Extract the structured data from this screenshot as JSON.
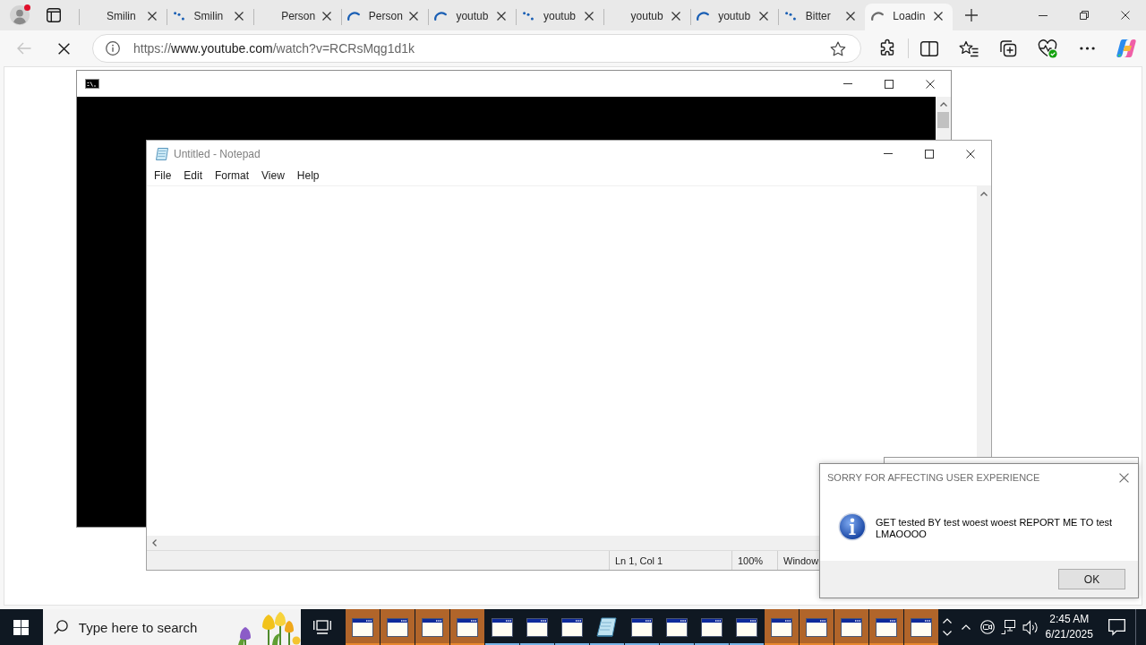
{
  "browser": {
    "tabs": [
      {
        "kind": "plain",
        "title": "Smilin",
        "selected": false
      },
      {
        "kind": "dots",
        "title": "Smilin",
        "selected": false
      },
      {
        "kind": "plain",
        "title": "Person",
        "selected": false
      },
      {
        "kind": "arc",
        "title": "Person",
        "selected": false
      },
      {
        "kind": "arc",
        "title": "youtub",
        "selected": false
      },
      {
        "kind": "dots",
        "title": "youtub",
        "selected": false
      },
      {
        "kind": "plain",
        "title": "youtub",
        "selected": false
      },
      {
        "kind": "arc",
        "title": "youtub",
        "selected": false
      },
      {
        "kind": "dots",
        "title": "Bitter",
        "selected": false
      },
      {
        "kind": "arc",
        "title": "Loadin",
        "selected": true
      }
    ],
    "navigation": {
      "back_disabled": true,
      "loading": true
    },
    "address_bar": {
      "scheme": "https://",
      "host": "www.youtube.com",
      "path": "/watch?v=RCRsMqg1d1k"
    }
  },
  "notepad": {
    "title": "Untitled - Notepad",
    "menu": [
      "File",
      "Edit",
      "Format",
      "View",
      "Help"
    ],
    "status": [
      "Ln 1, Col 1",
      "100%",
      "Window"
    ]
  },
  "dialog": {
    "title": "SORRY FOR AFFECTING USER EXPERIENCE",
    "message": "GET tested BY test woest woest REPORT ME TO test LMAOOOO",
    "button": "OK"
  },
  "taskbar": {
    "search": {
      "placeholder": "Type here to search"
    },
    "apps": [
      {
        "kind": "window",
        "flashing": true,
        "running": true
      },
      {
        "kind": "window",
        "flashing": true,
        "running": true
      },
      {
        "kind": "window",
        "flashing": true,
        "running": true
      },
      {
        "kind": "window",
        "flashing": true,
        "running": true
      },
      {
        "kind": "window",
        "flashing": false,
        "running": true
      },
      {
        "kind": "window",
        "flashing": false,
        "running": true
      },
      {
        "kind": "window",
        "flashing": false,
        "running": true
      },
      {
        "kind": "notepad",
        "flashing": false,
        "running": true
      },
      {
        "kind": "window",
        "flashing": false,
        "running": true
      },
      {
        "kind": "window",
        "flashing": false,
        "running": true
      },
      {
        "kind": "window",
        "flashing": false,
        "running": true
      },
      {
        "kind": "window",
        "flashing": false,
        "running": true
      },
      {
        "kind": "window",
        "flashing": true,
        "running": true
      },
      {
        "kind": "window",
        "flashing": true,
        "running": true
      },
      {
        "kind": "window",
        "flashing": true,
        "running": true
      },
      {
        "kind": "window",
        "flashing": true,
        "running": true
      },
      {
        "kind": "window",
        "flashing": true,
        "running": true
      }
    ],
    "clock": {
      "time": "2:45 AM",
      "date": "6/21/2025"
    }
  }
}
